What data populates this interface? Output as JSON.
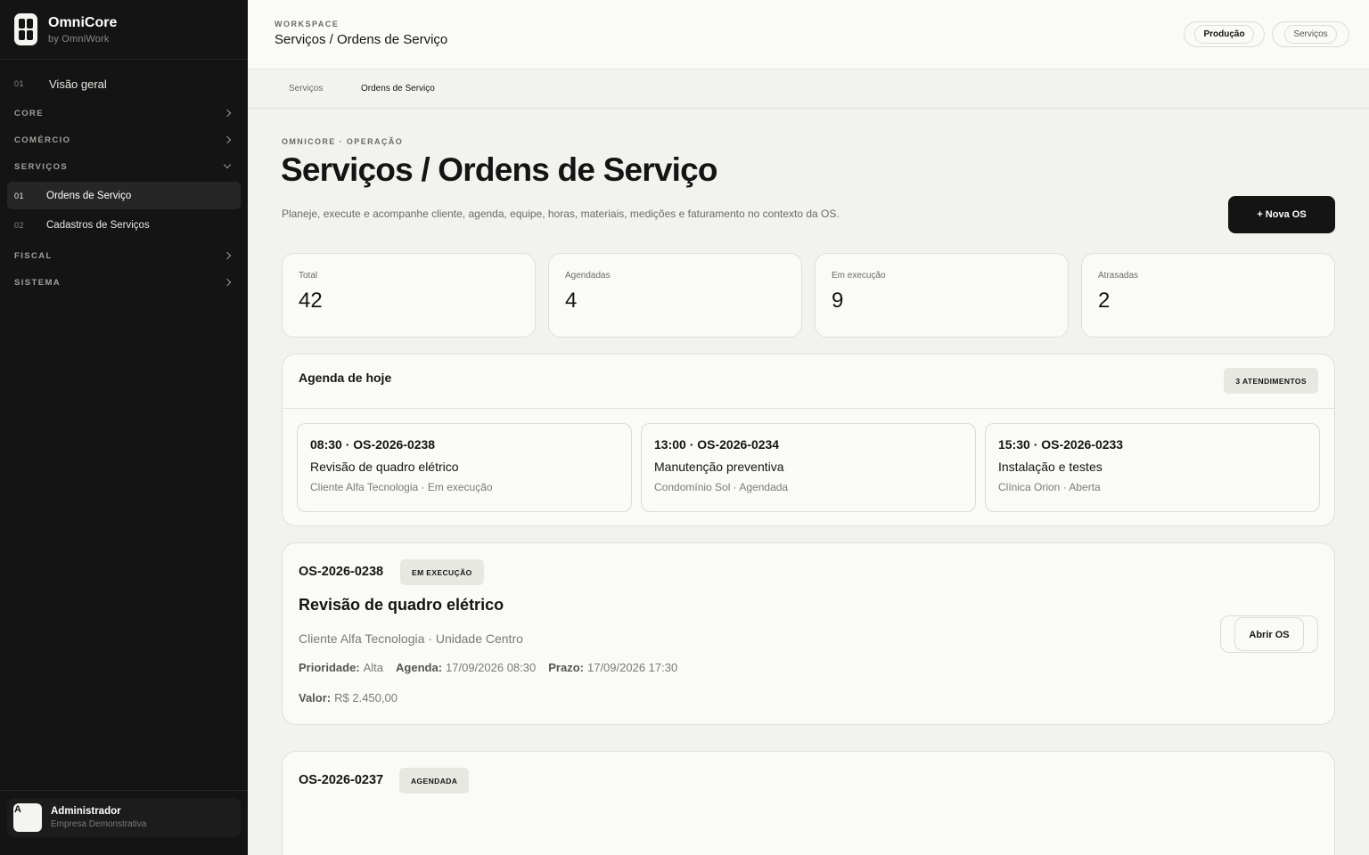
{
  "sidebar": {
    "brand_name": "OmniCore",
    "brand_sub": "by OmniWork",
    "overview": {
      "num": "01",
      "label": "Visão geral"
    },
    "sections": {
      "core": "CORE",
      "comercio": "COMÉRCIO",
      "servicos": "SERVIÇOS",
      "fiscal": "FISCAL",
      "sistema": "SISTEMA"
    },
    "servicos_items": [
      {
        "num": "01",
        "label": "Ordens de Serviço"
      },
      {
        "num": "02",
        "label": "Cadastros de Serviços"
      }
    ],
    "user": {
      "initial": "A",
      "name": "Administrador",
      "company": "Empresa Demonstrativa"
    }
  },
  "header": {
    "workspace_label": "WORKSPACE",
    "title": "Serviços / Ordens de Serviço",
    "chip_production": "Produção",
    "chip_services": "Serviços"
  },
  "tabs": [
    "Serviços",
    "Ordens de Serviço"
  ],
  "main": {
    "eyebrow": "OMNICORE · OPERAÇÃO",
    "title": "Serviços / Ordens de Serviço",
    "description": "Planeje, execute e acompanhe cliente, agenda, equipe, horas, materiais, medições e faturamento no contexto da OS.",
    "new_button": "+ Nova OS"
  },
  "stats": [
    {
      "label": "Total",
      "value": "42"
    },
    {
      "label": "Agendadas",
      "value": "4"
    },
    {
      "label": "Em execução",
      "value": "9"
    },
    {
      "label": "Atrasadas",
      "value": "2"
    }
  ],
  "agenda": {
    "title": "Agenda de hoje",
    "count": "3 ATENDIMENTOS",
    "slots": [
      {
        "head": "08:30 · OS-2026-0238",
        "title": "Revisão de quadro elétrico",
        "meta": "Cliente Alfa Tecnologia · Em execução"
      },
      {
        "head": "13:00 · OS-2026-0234",
        "title": "Manutenção preventiva",
        "meta": "Condomínio Sol · Agendada"
      },
      {
        "head": "15:30 · OS-2026-0233",
        "title": "Instalação e testes",
        "meta": "Clínica Orion · Aberta"
      }
    ]
  },
  "orders": [
    {
      "code": "OS-2026-0238",
      "status": "EM EXECUÇÃO",
      "title": "Revisão de quadro elétrico",
      "client": "Cliente Alfa Tecnologia · Unidade Centro",
      "priority_label": "Prioridade:",
      "priority": "Alta",
      "schedule_label": "Agenda:",
      "schedule": "17/09/2026 08:30",
      "deadline_label": "Prazo:",
      "deadline": "17/09/2026 17:30",
      "value_label": "Valor:",
      "value": "R$ 2.450,00",
      "open_button": "Abrir OS"
    },
    {
      "code": "OS-2026-0237",
      "status": "AGENDADA"
    }
  ],
  "colors": {
    "sidebar_bg": "#141414",
    "page_bg": "#f2f2ee",
    "card_bg": "#fafaf7",
    "primary_button": "#141414",
    "badge_bg": "#e8e8e3"
  },
  "icons": {
    "collapsed": "chevron-right-icon",
    "expanded": "chevron-down-icon",
    "logo": "omnicore-logo-icon"
  }
}
